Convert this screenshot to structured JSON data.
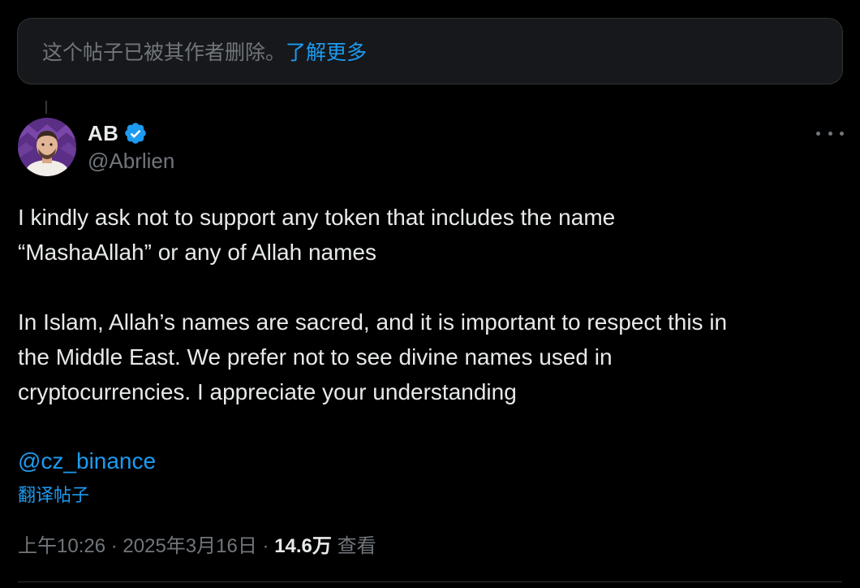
{
  "banner": {
    "message": "这个帖子已被其作者删除。",
    "link_label": "了解更多"
  },
  "author": {
    "name": "AB",
    "handle": "@Abrlien",
    "verified": true
  },
  "tweet": {
    "paragraph1_line1": "I kindly ask not to support any token that includes the name",
    "paragraph1_line2": "“MashaAllah” or any of Allah names",
    "paragraph2_line1": "In Islam, Allah’s names are sacred, and it is important to respect this in",
    "paragraph2_line2": "the Middle East. We prefer not to see divine names used in",
    "paragraph2_line3": "cryptocurrencies. I appreciate your understanding",
    "mention": "@cz_binance",
    "translate_label": "翻译帖子"
  },
  "meta": {
    "time": "上午10:26",
    "separator": "·",
    "date": "2025年3月16日",
    "views_count": "14.6万",
    "views_label": "查看"
  },
  "colors": {
    "background": "#000000",
    "text": "#e7e9ea",
    "muted": "#71767b",
    "link": "#1d9bf0",
    "banner_bg": "#16181c"
  }
}
